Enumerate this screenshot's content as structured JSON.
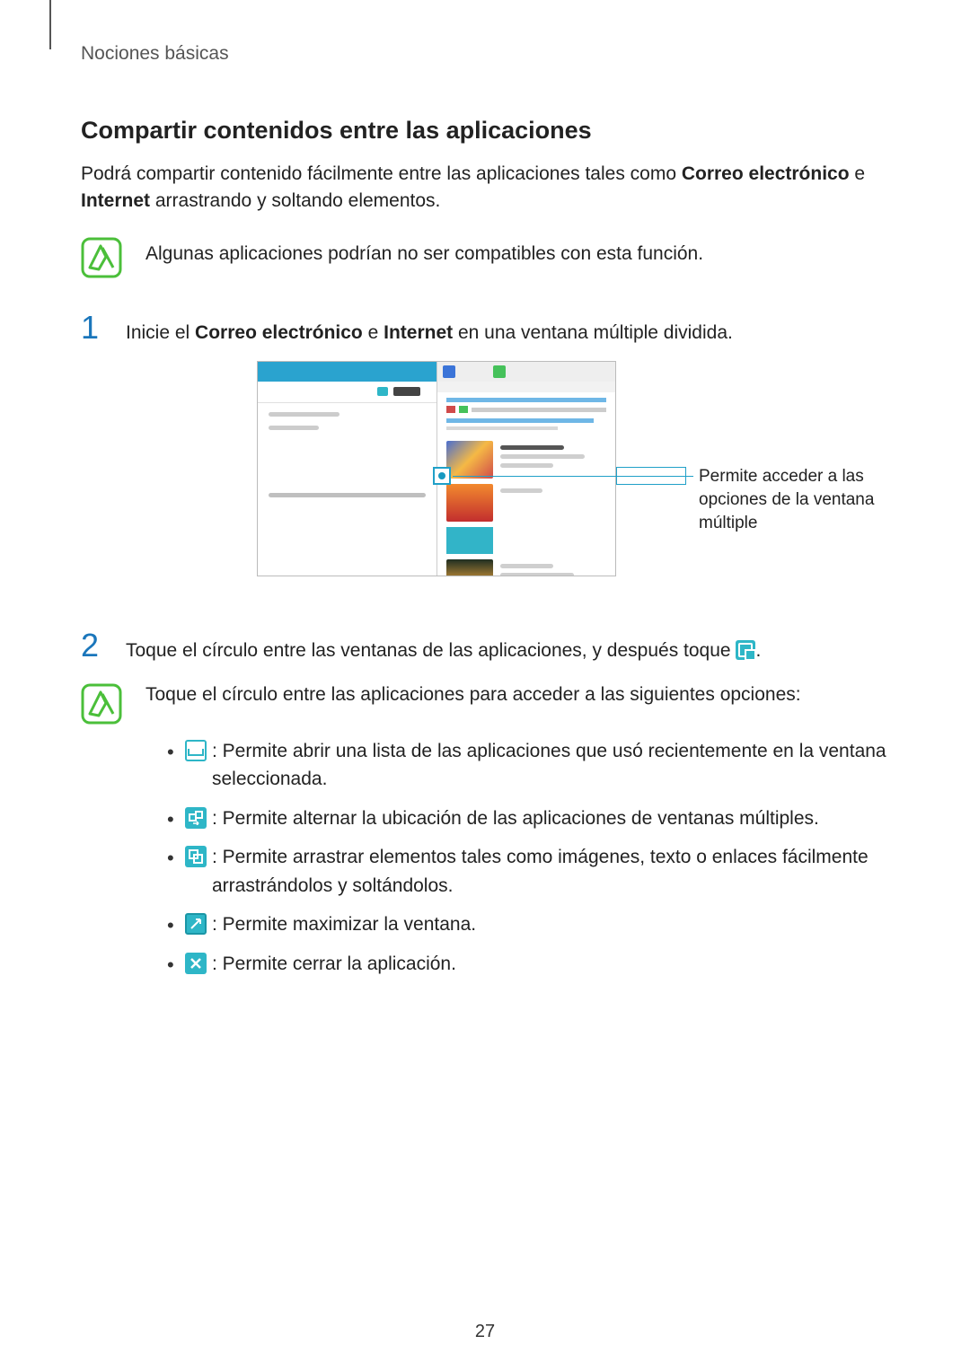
{
  "breadcrumb": "Nociones básicas",
  "section_title": "Compartir contenidos entre las aplicaciones",
  "intro": {
    "pre": "Podrá compartir contenido fácilmente entre las aplicaciones tales como ",
    "b1": "Correo electrónico",
    "mid": " e ",
    "b2": "Internet",
    "post": " arrastrando y soltando elementos."
  },
  "note1": "Algunas aplicaciones podrían no ser compatibles con esta función.",
  "step1": {
    "num": "1",
    "pre": "Inicie el ",
    "b1": "Correo electrónico",
    "mid": " e ",
    "b2": "Internet",
    "post": " en una ventana múltiple dividida."
  },
  "callout": "Permite acceder a las opciones de la ventana múltiple",
  "step2": {
    "num": "2",
    "pre": "Toque el círculo entre las ventanas de las aplicaciones, y después toque ",
    "post": "."
  },
  "tip_intro": "Toque el círculo entre las aplicaciones para acceder a las siguientes opciones:",
  "bullets": [
    {
      "icon": "window-icon",
      "text": ": Permite abrir una lista de las aplicaciones que usó recientemente en la ventana seleccionada."
    },
    {
      "icon": "swap-icon",
      "text": ": Permite alternar la ubicación de las aplicaciones de ventanas múltiples."
    },
    {
      "icon": "drag-icon",
      "text": ": Permite arrastrar elementos tales como imágenes, texto o enlaces fácilmente arrastrándolos y soltándolos."
    },
    {
      "icon": "maximize-icon",
      "text": ": Permite maximizar la ventana."
    },
    {
      "icon": "close-icon",
      "text": ": Permite cerrar la aplicación."
    }
  ],
  "page_number": "27"
}
